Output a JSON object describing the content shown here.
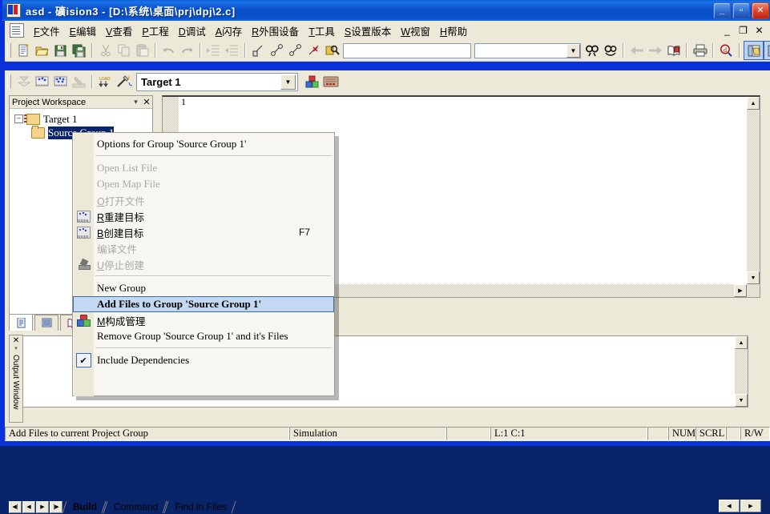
{
  "window": {
    "title": "asd  -  礦ision3 - [D:\\系统\\桌面\\prj\\dpj\\2.c]",
    "app_icon": "keil-uvision-icon",
    "minimize": "_",
    "maximize": "▫",
    "close": "✕",
    "mdi_minimize": "_",
    "mdi_restore": "❐",
    "mdi_close": "✕"
  },
  "menubar": {
    "doc_icon": "document-icon",
    "items": [
      {
        "mnemonic": "F",
        "label": "文件"
      },
      {
        "mnemonic": "E",
        "label": "编辑"
      },
      {
        "mnemonic": "V",
        "label": "查看"
      },
      {
        "mnemonic": "P",
        "label": "工程"
      },
      {
        "mnemonic": "D",
        "label": "调试"
      },
      {
        "mnemonic": "A",
        "label": "闪存"
      },
      {
        "mnemonic": "R",
        "label": "外围设备"
      },
      {
        "mnemonic": "T",
        "label": "工具"
      },
      {
        "mnemonic": "S",
        "label": "设置版本"
      },
      {
        "mnemonic": "W",
        "label": "视窗"
      },
      {
        "mnemonic": "H",
        "label": "帮助"
      }
    ]
  },
  "toolbar_main": {
    "buttons": [
      "new-file-icon",
      "open-file-icon",
      "save-icon",
      "save-all-icon",
      "cut-icon",
      "copy-icon",
      "paste-icon",
      "undo-icon",
      "redo-icon",
      "indent-icon",
      "outdent-icon",
      "toggle-bookmark-icon",
      "next-bookmark-icon",
      "prev-bookmark-icon",
      "clear-bookmarks-icon",
      "find-in-files-icon"
    ],
    "search_value": "",
    "combo_value": "",
    "buttons_right": [
      "find-icon",
      "replace-icon",
      "back-icon",
      "forward-icon",
      "open-include-icon",
      "print-icon",
      "find-symbol-icon",
      "project-window-icon",
      "books-window-icon",
      "output-window-icon",
      "source-browser-icon",
      "functions-window-icon",
      "templates-window-icon"
    ]
  },
  "toolbar_build": {
    "buttons": [
      "translate-icon",
      "build-target-icon",
      "rebuild-all-icon",
      "batch-build-icon",
      "download-icon",
      "target-options-icon"
    ],
    "target_value": "Target 1",
    "dropdown_arrow": "▼",
    "right_buttons": [
      "manage-components-icon",
      "multiproject-icon"
    ]
  },
  "workspace": {
    "caption": "Project Workspace",
    "minimize_glyph": "▾",
    "close_glyph": "✕",
    "tree": {
      "expander": "–",
      "root": "Target 1",
      "root_icon": "target-icon",
      "child": "Source Group 1",
      "child_icon": "folder-icon",
      "child_selected": true
    },
    "tabs": [
      "files-tab-icon",
      "regs-tab-icon",
      "books-tab-icon"
    ]
  },
  "editor": {
    "line_number": "1",
    "content": ""
  },
  "output_window": {
    "title": "Output Window",
    "close_glyph": "✕",
    "minimize_glyph": "▾",
    "nav_first": "◀|",
    "nav_prev": "◀",
    "nav_next": "▶",
    "nav_last": "|▶",
    "tabs": [
      {
        "label": "Build",
        "active": true
      },
      {
        "label": "Command",
        "active": false
      },
      {
        "label": "Find in Files",
        "active": false
      }
    ],
    "hscroll_left": "◀",
    "hscroll_right": "▶"
  },
  "context_menu": {
    "items": [
      {
        "id": "options-for-group",
        "label": "Options for Group 'Source Group 1'",
        "icon": null,
        "shortcut": "",
        "state": "normal",
        "lang": "en"
      },
      {
        "id": "sep1",
        "type": "separator"
      },
      {
        "id": "open-list-file",
        "label": "Open List File",
        "icon": null,
        "shortcut": "",
        "state": "disabled",
        "lang": "en",
        "underline_index": 12
      },
      {
        "id": "open-map-file",
        "label": "Open Map File",
        "icon": null,
        "shortcut": "",
        "state": "disabled",
        "lang": "en"
      },
      {
        "id": "open-file-cn",
        "mnemonic": "O",
        "label": "打开文件",
        "icon": null,
        "shortcut": "",
        "state": "disabled",
        "lang": "cn"
      },
      {
        "id": "rebuild-target",
        "mnemonic": "R",
        "label": "重建目标",
        "icon": "rebuild-icon",
        "shortcut": "",
        "state": "normal",
        "lang": "cn"
      },
      {
        "id": "build-target",
        "mnemonic": "B",
        "label": "创建目标",
        "icon": "build-icon",
        "shortcut": "F7",
        "state": "normal",
        "lang": "cn"
      },
      {
        "id": "translate-file",
        "label": "编译文件",
        "icon": null,
        "shortcut": "",
        "state": "disabled",
        "lang": "cn"
      },
      {
        "id": "stop-build",
        "mnemonic": "U",
        "label": "停止创建",
        "icon": "stop-build-icon",
        "shortcut": "",
        "state": "disabled",
        "lang": "cn"
      },
      {
        "id": "sep2",
        "type": "separator"
      },
      {
        "id": "new-group",
        "label": "New Group",
        "icon": null,
        "shortcut": "",
        "state": "normal",
        "lang": "en"
      },
      {
        "id": "add-files-to-group",
        "label": "Add Files to Group 'Source Group 1'",
        "icon": null,
        "shortcut": "",
        "state": "selected",
        "lang": "en"
      },
      {
        "id": "manage-components",
        "mnemonic": "M",
        "label": "构成管理",
        "icon": "components-icon",
        "shortcut": "",
        "state": "normal",
        "lang": "cn"
      },
      {
        "id": "remove-group",
        "label": "Remove Group 'Source Group 1' and it's Files",
        "icon": null,
        "shortcut": "",
        "state": "normal",
        "lang": "en"
      },
      {
        "id": "sep3",
        "type": "separator"
      },
      {
        "id": "include-dependencies",
        "label": "Include Dependencies",
        "icon": "checkbox-checked",
        "shortcut": "",
        "state": "checked",
        "lang": "en"
      }
    ]
  },
  "statusbar": {
    "message": "Add Files to current Project Group",
    "simulation": "Simulation",
    "blank1": "",
    "cursor_pos": "L:1 C:1",
    "blank2": "",
    "num": "NUM",
    "scrl": "SCRL",
    "blank3": "",
    "rw": "R/W"
  }
}
